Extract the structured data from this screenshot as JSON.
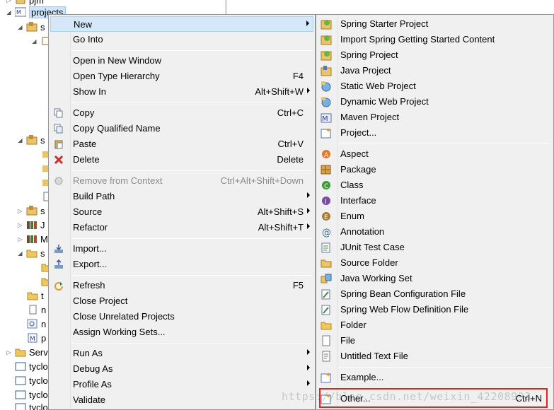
{
  "tree": {
    "items": [
      {
        "label": "pjm",
        "icon": "project-icon"
      },
      {
        "label": "projects",
        "icon": "maven-project-icon"
      },
      {
        "label": "s",
        "icon": "package-folder-icon"
      },
      {
        "label": "s",
        "icon": "package-folder-icon"
      },
      {
        "label": "s",
        "icon": "package-folder-icon"
      },
      {
        "label": "J",
        "icon": "library-icon"
      },
      {
        "label": "M",
        "icon": "library-icon"
      },
      {
        "label": "s",
        "icon": "folder-icon"
      },
      {
        "label": "t",
        "icon": "folder-icon"
      },
      {
        "label": "n",
        "icon": "file-icon"
      },
      {
        "label": "n",
        "icon": "file-icon"
      },
      {
        "label": "p",
        "icon": "maven-file-icon"
      },
      {
        "label": "Serv",
        "icon": "folder-icon"
      },
      {
        "label": "tyclo",
        "icon": "folder-icon"
      },
      {
        "label": "tyclo",
        "icon": "folder-icon"
      },
      {
        "label": "tyclo",
        "icon": "folder-icon"
      },
      {
        "label": "tyclo",
        "icon": "folder-icon"
      }
    ]
  },
  "context_menu": {
    "items": [
      {
        "label": "New",
        "shortcut": "",
        "submenu": true,
        "highlighted": true
      },
      {
        "label": "Go Into",
        "shortcut": ""
      },
      {
        "label": "Open in New Window",
        "shortcut": ""
      },
      {
        "label": "Open Type Hierarchy",
        "shortcut": "F4"
      },
      {
        "label": "Show In",
        "shortcut": "Alt+Shift+W",
        "submenu": true
      },
      {
        "label": "Copy",
        "shortcut": "Ctrl+C",
        "icon": "copy-icon"
      },
      {
        "label": "Copy Qualified Name",
        "shortcut": "",
        "icon": "copy-qualified-icon"
      },
      {
        "label": "Paste",
        "shortcut": "Ctrl+V",
        "icon": "paste-icon"
      },
      {
        "label": "Delete",
        "shortcut": "Delete",
        "icon": "delete-icon"
      },
      {
        "label": "Remove from Context",
        "shortcut": "Ctrl+Alt+Shift+Down",
        "disabled": true,
        "icon": "remove-context-icon"
      },
      {
        "label": "Build Path",
        "shortcut": "",
        "submenu": true
      },
      {
        "label": "Source",
        "shortcut": "Alt+Shift+S",
        "submenu": true
      },
      {
        "label": "Refactor",
        "shortcut": "Alt+Shift+T",
        "submenu": true
      },
      {
        "label": "Import...",
        "shortcut": "",
        "icon": "import-icon"
      },
      {
        "label": "Export...",
        "shortcut": "",
        "icon": "export-icon"
      },
      {
        "label": "Refresh",
        "shortcut": "F5",
        "icon": "refresh-icon"
      },
      {
        "label": "Close Project",
        "shortcut": ""
      },
      {
        "label": "Close Unrelated Projects",
        "shortcut": ""
      },
      {
        "label": "Assign Working Sets...",
        "shortcut": ""
      },
      {
        "label": "Run As",
        "shortcut": "",
        "submenu": true
      },
      {
        "label": "Debug As",
        "shortcut": "",
        "submenu": true
      },
      {
        "label": "Profile As",
        "shortcut": "",
        "submenu": true
      },
      {
        "label": "Validate",
        "shortcut": ""
      }
    ]
  },
  "new_submenu": {
    "items": [
      {
        "label": "Spring Starter Project",
        "icon": "spring-starter-icon"
      },
      {
        "label": "Import Spring Getting Started Content",
        "icon": "spring-import-icon"
      },
      {
        "label": "Spring Project",
        "icon": "spring-project-icon"
      },
      {
        "label": "Java Project",
        "icon": "java-project-icon"
      },
      {
        "label": "Static Web Project",
        "icon": "static-web-icon"
      },
      {
        "label": "Dynamic Web Project",
        "icon": "dynamic-web-icon"
      },
      {
        "label": "Maven Project",
        "icon": "maven-project-icon"
      },
      {
        "label": "Project...",
        "icon": "project-wizard-icon"
      },
      {
        "label": "Aspect",
        "icon": "aspect-icon"
      },
      {
        "label": "Package",
        "icon": "package-icon"
      },
      {
        "label": "Class",
        "icon": "class-icon"
      },
      {
        "label": "Interface",
        "icon": "interface-icon"
      },
      {
        "label": "Enum",
        "icon": "enum-icon"
      },
      {
        "label": "Annotation",
        "icon": "annotation-icon"
      },
      {
        "label": "JUnit Test Case",
        "icon": "junit-icon"
      },
      {
        "label": "Source Folder",
        "icon": "source-folder-icon"
      },
      {
        "label": "Java Working Set",
        "icon": "working-set-icon"
      },
      {
        "label": "Spring Bean Configuration File",
        "icon": "spring-bean-icon"
      },
      {
        "label": "Spring Web Flow Definition File",
        "icon": "spring-webflow-icon"
      },
      {
        "label": "Folder",
        "icon": "folder-icon"
      },
      {
        "label": "File",
        "icon": "file-icon"
      },
      {
        "label": "Untitled Text File",
        "icon": "text-file-icon"
      },
      {
        "label": "Example...",
        "icon": "example-icon"
      },
      {
        "label": "Other...",
        "shortcut": "Ctrl+N",
        "icon": "other-wizard-icon"
      }
    ]
  },
  "watermark": "https://blog.csdn.net/weixin_42208993",
  "colors": {
    "highlight_box": "#e02525",
    "menu_highlight": "#d5e8fa",
    "menu_bg": "#f0f0f0"
  }
}
